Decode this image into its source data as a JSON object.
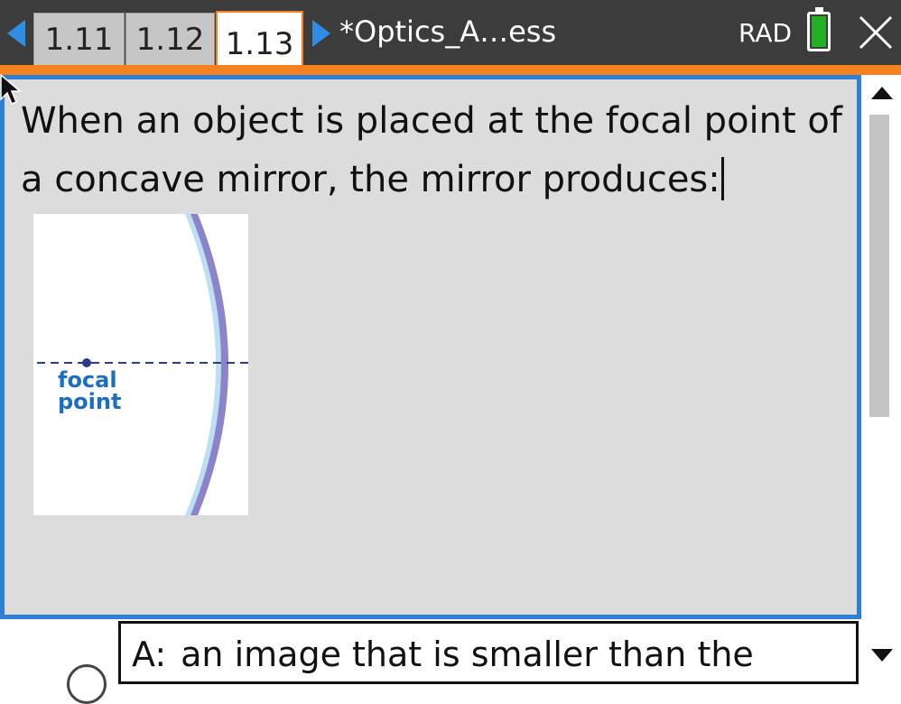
{
  "header": {
    "tabs": [
      {
        "label": "1.11",
        "active": false
      },
      {
        "label": "1.12",
        "active": false
      },
      {
        "label": "1.13",
        "active": true
      }
    ],
    "document_title": "*Optics_A…ess",
    "angle_mode": "RAD",
    "battery_icon": "battery-icon",
    "close_icon": "close-icon"
  },
  "question": {
    "text": "When an object is placed at the focal point of a concave mirror, the mirror produces:",
    "figure_label": "focal point"
  },
  "answers": [
    {
      "letter": "A:",
      "text": "an image that is smaller than the"
    }
  ],
  "colors": {
    "accent_orange": "#f5821f",
    "accent_blue": "#2f7fd6",
    "topbar": "#3c3c3c",
    "battery_green": "#22b024"
  }
}
